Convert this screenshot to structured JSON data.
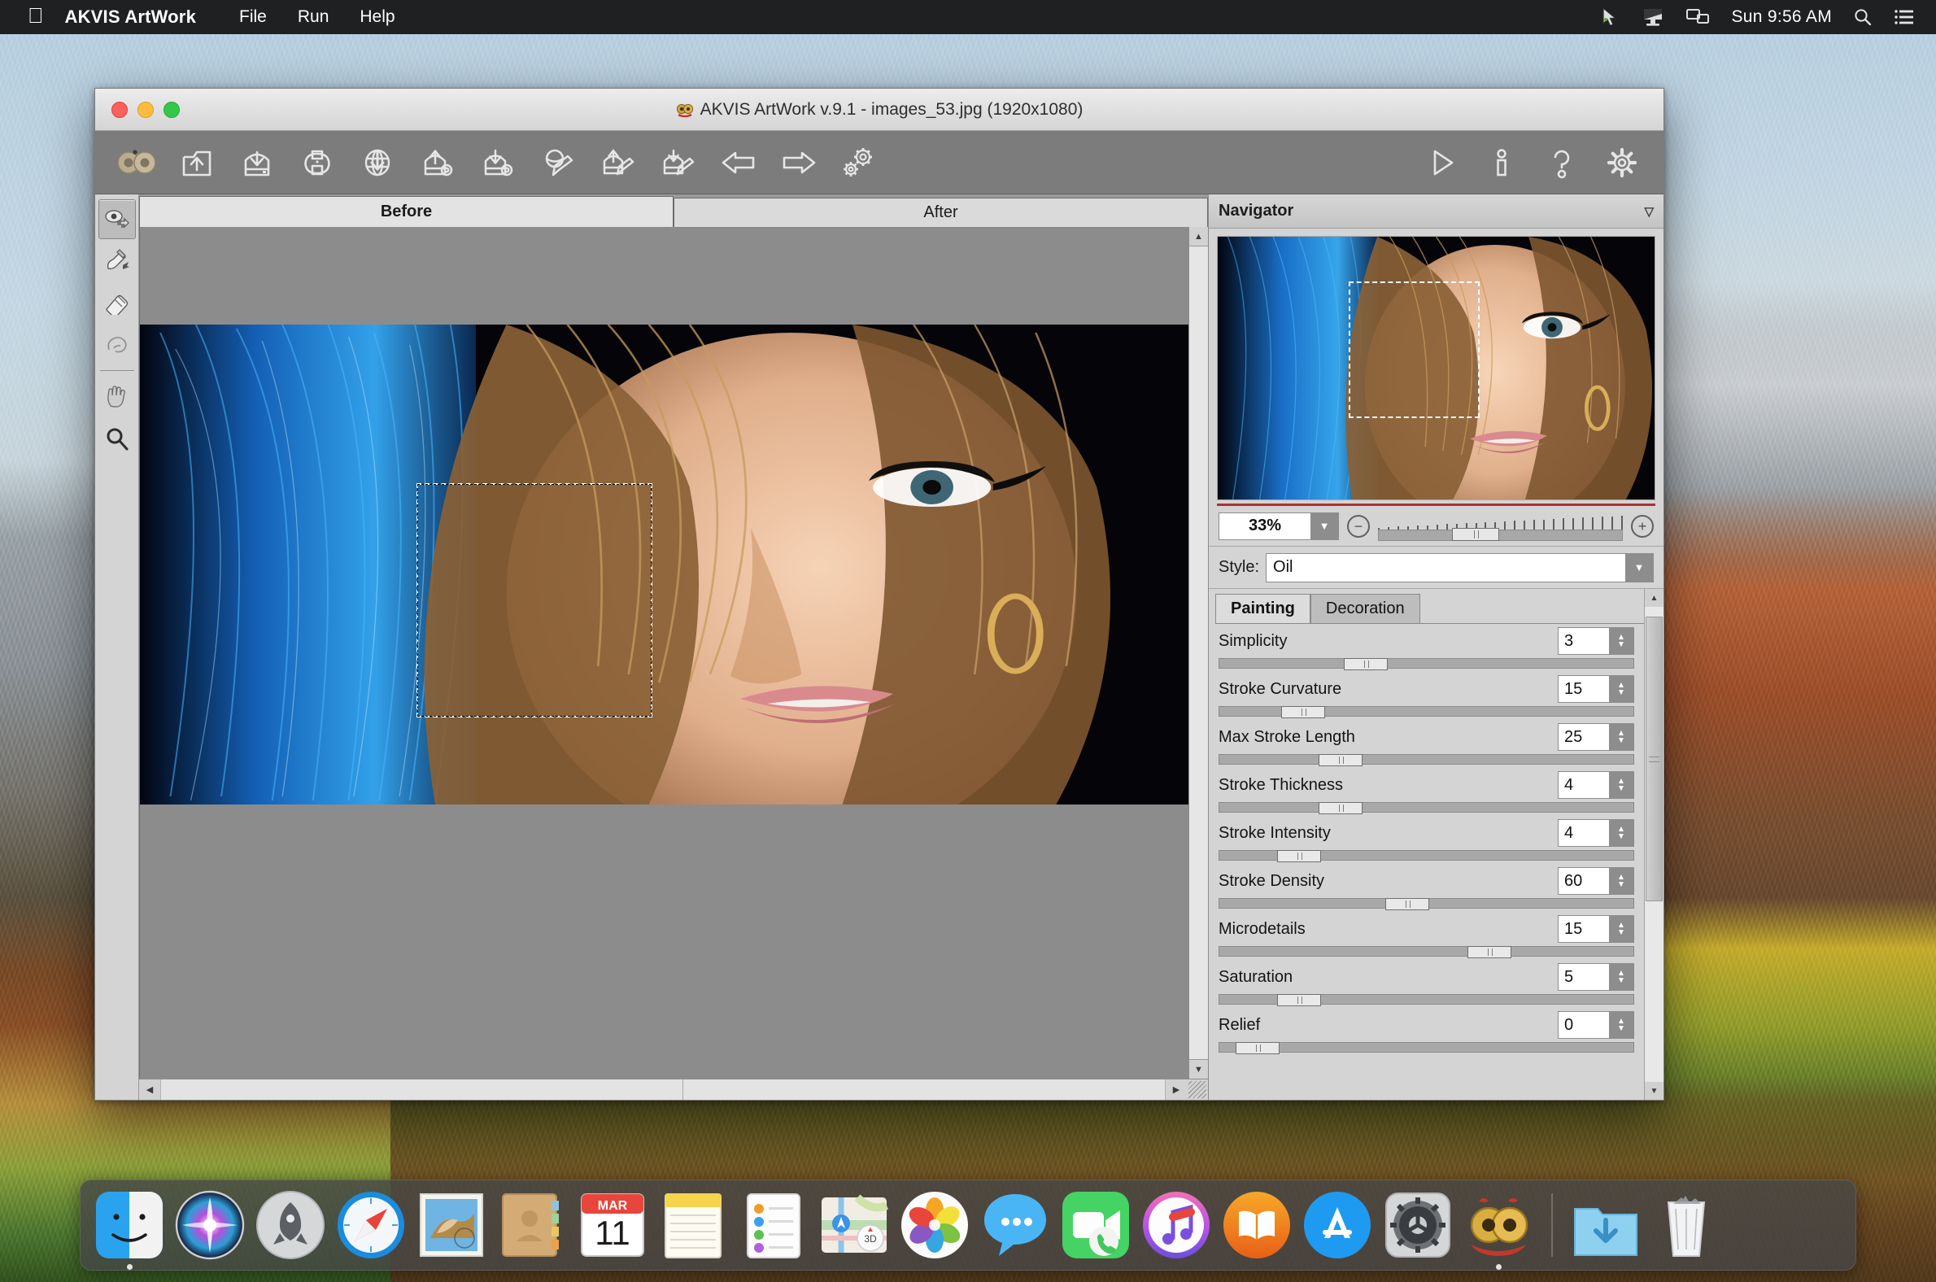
{
  "menubar": {
    "apple_icon": "apple-logo-icon",
    "app_name": "AKVIS ArtWork",
    "items": [
      "File",
      "Run",
      "Help"
    ],
    "right_icons": [
      "cursor-pointer-icon",
      "screen-sharing-icon",
      "display-mirror-icon"
    ],
    "clock": "Sun 9:56 AM",
    "search_icon": "search-icon",
    "control-center_icon": "list-icon"
  },
  "window": {
    "title": "AKVIS ArtWork v.9.1 - images_53.jpg (1920x1080)",
    "traffic_lights": [
      "close-button",
      "minimize-button",
      "zoom-button"
    ]
  },
  "toolbar": {
    "buttons": [
      {
        "name": "akvis-logo-icon",
        "label": "AKVIS"
      },
      {
        "name": "open-image-icon",
        "label": "Open Image"
      },
      {
        "name": "save-image-icon",
        "label": "Save Image"
      },
      {
        "name": "print-image-icon",
        "label": "Print Image"
      },
      {
        "name": "publish-web-icon",
        "label": "Publish Image"
      },
      {
        "name": "load-preset-icon",
        "label": "Load Preset"
      },
      {
        "name": "save-preset-icon",
        "label": "Save Preset"
      },
      {
        "name": "canvas-preview-icon",
        "label": "Quick Preview"
      },
      {
        "name": "load-settings-icon",
        "label": "Load Settings"
      },
      {
        "name": "save-settings-icon",
        "label": "Save Settings"
      },
      {
        "name": "undo-arrow-icon",
        "label": "Undo"
      },
      {
        "name": "redo-arrow-icon",
        "label": "Redo"
      },
      {
        "name": "batch-gears-icon",
        "label": "Batch Processing"
      }
    ],
    "right_buttons": [
      {
        "name": "run-play-icon",
        "label": "Run"
      },
      {
        "name": "info-icon",
        "label": "About"
      },
      {
        "name": "help-icon",
        "label": "Help"
      },
      {
        "name": "preferences-gear-icon",
        "label": "Preferences"
      }
    ]
  },
  "left_tools": [
    {
      "name": "tool-smudge-direction-icon",
      "label": "Stroke Direction",
      "active": true
    },
    {
      "name": "tool-brush-icon",
      "label": "Direction Brush",
      "active": false
    },
    {
      "name": "tool-eraser-icon",
      "label": "Eraser",
      "active": false
    },
    {
      "name": "tool-history-brush-icon",
      "label": "History Brush",
      "active": false
    },
    {
      "name": "tool-hand-icon",
      "label": "Hand",
      "active": false
    },
    {
      "name": "tool-zoom-icon",
      "label": "Zoom",
      "active": false
    }
  ],
  "canvas": {
    "tabs": [
      {
        "label": "Before",
        "active": true
      },
      {
        "label": "After",
        "active": false
      }
    ],
    "image_name": "images_53.jpg",
    "selection_marquee": true
  },
  "navigator": {
    "title": "Navigator",
    "collapse_icon": "chevron-down-icon",
    "zoom_value": "33%",
    "zoom_out_icon": "minus-circle-icon",
    "zoom_in_icon": "plus-circle-icon",
    "zoom_dropdown_icon": "chevron-down-icon"
  },
  "settings": {
    "style_label": "Style:",
    "style_value": "Oil",
    "style_dropdown_icon": "chevron-down-icon",
    "tabs": [
      {
        "label": "Painting",
        "active": true
      },
      {
        "label": "Decoration",
        "active": false
      }
    ],
    "params": [
      {
        "name": "Simplicity",
        "value": "3",
        "slider_pct": 30
      },
      {
        "name": "Stroke Curvature",
        "value": "15",
        "slider_pct": 15
      },
      {
        "name": "Max Stroke Length",
        "value": "25",
        "slider_pct": 24
      },
      {
        "name": "Stroke Thickness",
        "value": "4",
        "slider_pct": 24
      },
      {
        "name": "Stroke Intensity",
        "value": "4",
        "slider_pct": 14
      },
      {
        "name": "Stroke Density",
        "value": "60",
        "slider_pct": 40
      },
      {
        "name": "Microdetails",
        "value": "15",
        "slider_pct": 60
      },
      {
        "name": "Saturation",
        "value": "5",
        "slider_pct": 14
      },
      {
        "name": "Relief",
        "value": "0",
        "slider_pct": 4
      }
    ]
  },
  "dock": {
    "items": [
      {
        "name": "dock-finder-icon",
        "label": "Finder"
      },
      {
        "name": "dock-siri-icon",
        "label": "Siri"
      },
      {
        "name": "dock-launchpad-icon",
        "label": "Launchpad"
      },
      {
        "name": "dock-safari-icon",
        "label": "Safari"
      },
      {
        "name": "dock-mail-icon",
        "label": "Mail"
      },
      {
        "name": "dock-contacts-icon",
        "label": "Contacts"
      },
      {
        "name": "dock-calendar-icon",
        "label": "Calendar"
      },
      {
        "name": "dock-notes-icon",
        "label": "Notes"
      },
      {
        "name": "dock-reminders-icon",
        "label": "Reminders"
      },
      {
        "name": "dock-maps-icon",
        "label": "Maps"
      },
      {
        "name": "dock-photos-icon",
        "label": "Photos"
      },
      {
        "name": "dock-messages-icon",
        "label": "Messages"
      },
      {
        "name": "dock-facetime-icon",
        "label": "FaceTime"
      },
      {
        "name": "dock-itunes-icon",
        "label": "iTunes"
      },
      {
        "name": "dock-ibooks-icon",
        "label": "iBooks"
      },
      {
        "name": "dock-appstore-icon",
        "label": "App Store"
      },
      {
        "name": "dock-system-preferences-icon",
        "label": "System Preferences"
      },
      {
        "name": "dock-akvis-artwork-icon",
        "label": "AKVIS ArtWork"
      },
      {
        "name": "dock-downloads-icon",
        "label": "Downloads"
      },
      {
        "name": "dock-trash-icon",
        "label": "Trash"
      }
    ],
    "calendar_month": "MAR",
    "calendar_day": "11"
  },
  "colors": {
    "menubar_bg": "#1f2022",
    "toolbar_bg": "#7c7c7c",
    "panel_bg": "#d4d4d4",
    "canvas_bg": "#8c8c8c",
    "accent_red": "#b03030"
  }
}
